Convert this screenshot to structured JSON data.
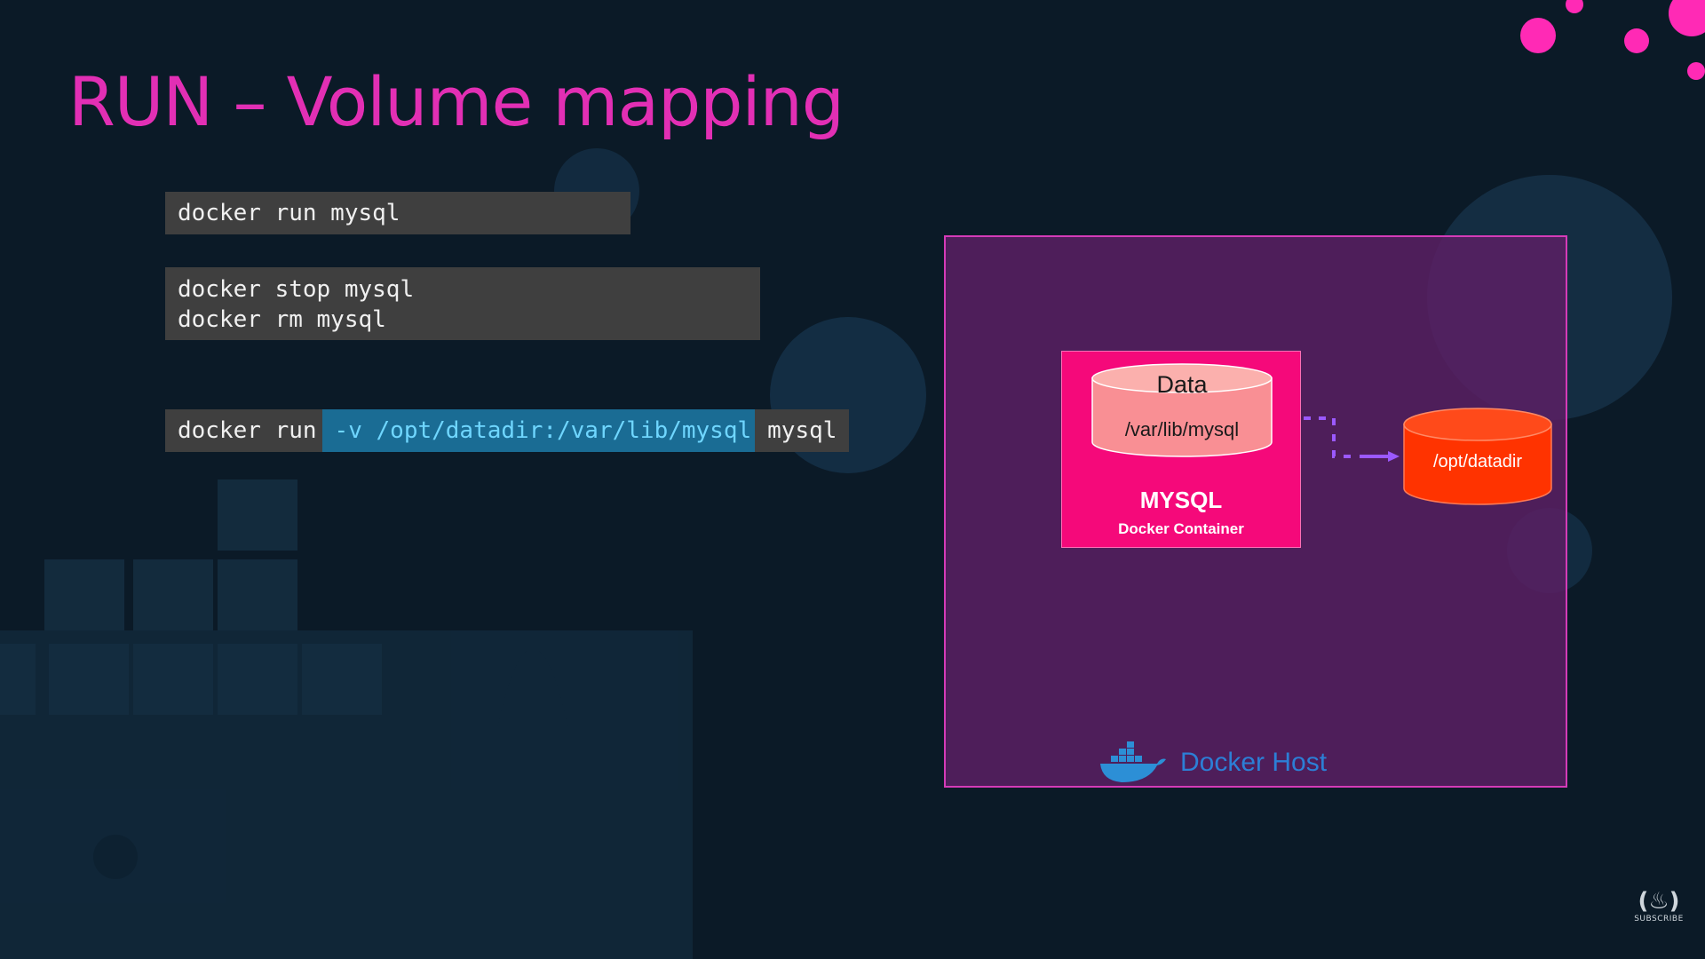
{
  "slide": {
    "title": "RUN – Volume mapping"
  },
  "commands": {
    "run": "docker run mysql",
    "stop": "docker stop mysql",
    "rm": "docker rm mysql",
    "volume_prefix": "docker run",
    "volume_flag": "-v /opt/datadir:/var/lib/mysql",
    "volume_suffix": "mysql"
  },
  "diagram": {
    "data_label": "Data",
    "container_path": "/var/lib/mysql",
    "container_name": "MYSQL",
    "container_type": "Docker Container",
    "host_path": "/opt/datadir",
    "host_label": "Docker Host"
  },
  "branding": {
    "subscribe": "SUBSCRIBE"
  },
  "colors": {
    "title": "#e22fb4",
    "host_border": "#d53bb8",
    "container_fill": "#f5097a",
    "host_volume_fill": "#ff3300",
    "arrow": "#9b59ff",
    "highlight": "#1a6c94"
  }
}
